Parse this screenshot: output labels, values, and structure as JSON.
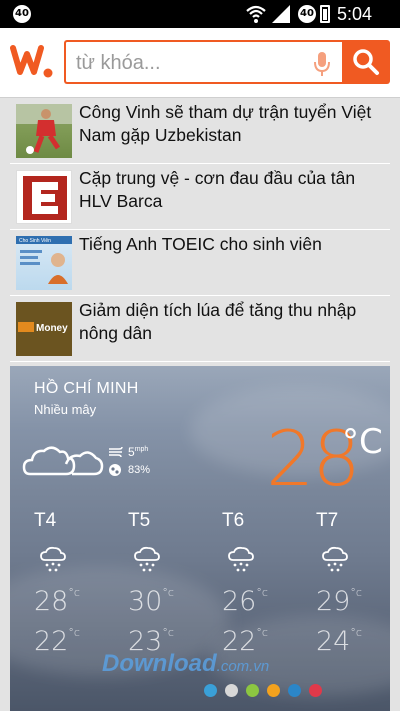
{
  "status_bar": {
    "left_badge": "40",
    "right_badge": "40",
    "time": "5:04 PM"
  },
  "search": {
    "placeholder": "từ khóa..."
  },
  "news": [
    {
      "title": "Công Vinh sẽ tham dự trận tuyển Việt Nam gặp Uzbekistan",
      "thumb_icon": "football-player-photo"
    },
    {
      "title": "Cặp trung vệ - cơn đau đầu của tân HLV Barca",
      "thumb_icon": "letter-e-logo"
    },
    {
      "title": "Tiếng Anh TOEIC cho sinh viên",
      "thumb_icon": "toeic-book-cover",
      "thumb_text": "Cho Sinh Viên"
    },
    {
      "title": "Giảm diện tích lúa để tăng thu nhập nông dân",
      "thumb_icon": "money-logo",
      "thumb_text": "Money"
    }
  ],
  "weather": {
    "city": "HỒ CHÍ MINH",
    "condition": "Nhiều mây",
    "wind": "5",
    "wind_unit": "mph",
    "humidity": "83%",
    "temperature": "28",
    "unit": "°C",
    "forecast": [
      {
        "day": "T4",
        "high": "28",
        "low": "22",
        "unit": "°c"
      },
      {
        "day": "T5",
        "high": "30",
        "low": "23",
        "unit": "°c"
      },
      {
        "day": "T6",
        "high": "26",
        "low": "22",
        "unit": "°c"
      },
      {
        "day": "T7",
        "high": "29",
        "low": "24",
        "unit": "°c"
      }
    ],
    "page_dots": [
      "#3aa0d8",
      "#d8d8d8",
      "#8cc641",
      "#f3a21e",
      "#2b86c8",
      "#e0394a"
    ]
  },
  "watermark": {
    "main": "Download",
    "suffix": ".com.vn"
  },
  "colors": {
    "accent": "#f05a22",
    "temperature": "#f0782a"
  }
}
